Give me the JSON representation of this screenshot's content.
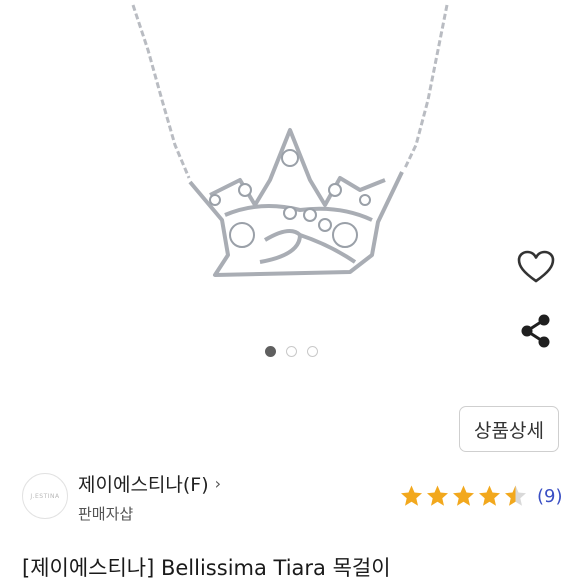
{
  "gallery": {
    "image_alt": "crown tiara necklace",
    "dot_count": 3,
    "active_index": 0
  },
  "actions": {
    "wishlist_icon": "heart-outline-icon",
    "share_icon": "share-icon"
  },
  "detail_button": {
    "label": "상품상세"
  },
  "seller": {
    "logo_text": "J.ESTINA",
    "name": "제이에스티나(F)",
    "chevron": "›",
    "type": "판매자샵"
  },
  "rating": {
    "stars": 4.5,
    "max": 5,
    "count_text": "(9)",
    "star_color": "#f2a81d"
  },
  "product": {
    "title": "[제이에스티나] Bellissima Tiara 목걸이"
  }
}
